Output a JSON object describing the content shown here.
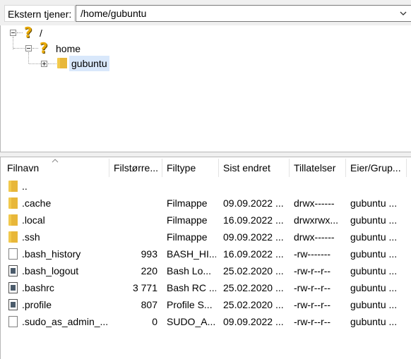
{
  "path_bar": {
    "label": "Ekstern tjener:",
    "path": "/home/gubuntu"
  },
  "tree": {
    "root": "/",
    "home": "home",
    "gubuntu": "gubuntu"
  },
  "list": {
    "columns": [
      "Filnavn",
      "Filstørre...",
      "Filtype",
      "Sist endret",
      "Tillatelser",
      "Eier/Grup..."
    ],
    "rows": [
      {
        "name": "..",
        "icon": "folder-icon",
        "size": "",
        "type": "",
        "modified": "",
        "perms": "",
        "owner": ""
      },
      {
        "name": ".cache",
        "icon": "folder-icon",
        "size": "",
        "type": "Filmappe",
        "modified": "09.09.2022 ...",
        "perms": "drwx------",
        "owner": "gubuntu ..."
      },
      {
        "name": ".local",
        "icon": "folder-icon",
        "size": "",
        "type": "Filmappe",
        "modified": "16.09.2022 ...",
        "perms": "drwxrwx...",
        "owner": "gubuntu ..."
      },
      {
        "name": ".ssh",
        "icon": "folder-icon",
        "size": "",
        "type": "Filmappe",
        "modified": "09.09.2022 ...",
        "perms": "drwx------",
        "owner": "gubuntu ..."
      },
      {
        "name": ".bash_history",
        "icon": "file-icon",
        "size": "993",
        "type": "BASH_HI...",
        "modified": "16.09.2022 ...",
        "perms": "-rw-------",
        "owner": "gubuntu ..."
      },
      {
        "name": ".bash_logout",
        "icon": "script-file-icon",
        "size": "220",
        "type": "Bash Lo...",
        "modified": "25.02.2020 ...",
        "perms": "-rw-r--r--",
        "owner": "gubuntu ..."
      },
      {
        "name": ".bashrc",
        "icon": "script-file-icon",
        "size": "3 771",
        "type": "Bash RC ...",
        "modified": "25.02.2020 ...",
        "perms": "-rw-r--r--",
        "owner": "gubuntu ..."
      },
      {
        "name": ".profile",
        "icon": "script-file-icon",
        "size": "807",
        "type": "Profile S...",
        "modified": "25.02.2020 ...",
        "perms": "-rw-r--r--",
        "owner": "gubuntu ..."
      },
      {
        "name": ".sudo_as_admin_...",
        "icon": "file-icon",
        "size": "0",
        "type": "SUDO_A...",
        "modified": "09.09.2022 ...",
        "perms": "-rw-r--r--",
        "owner": "gubuntu ..."
      }
    ]
  }
}
